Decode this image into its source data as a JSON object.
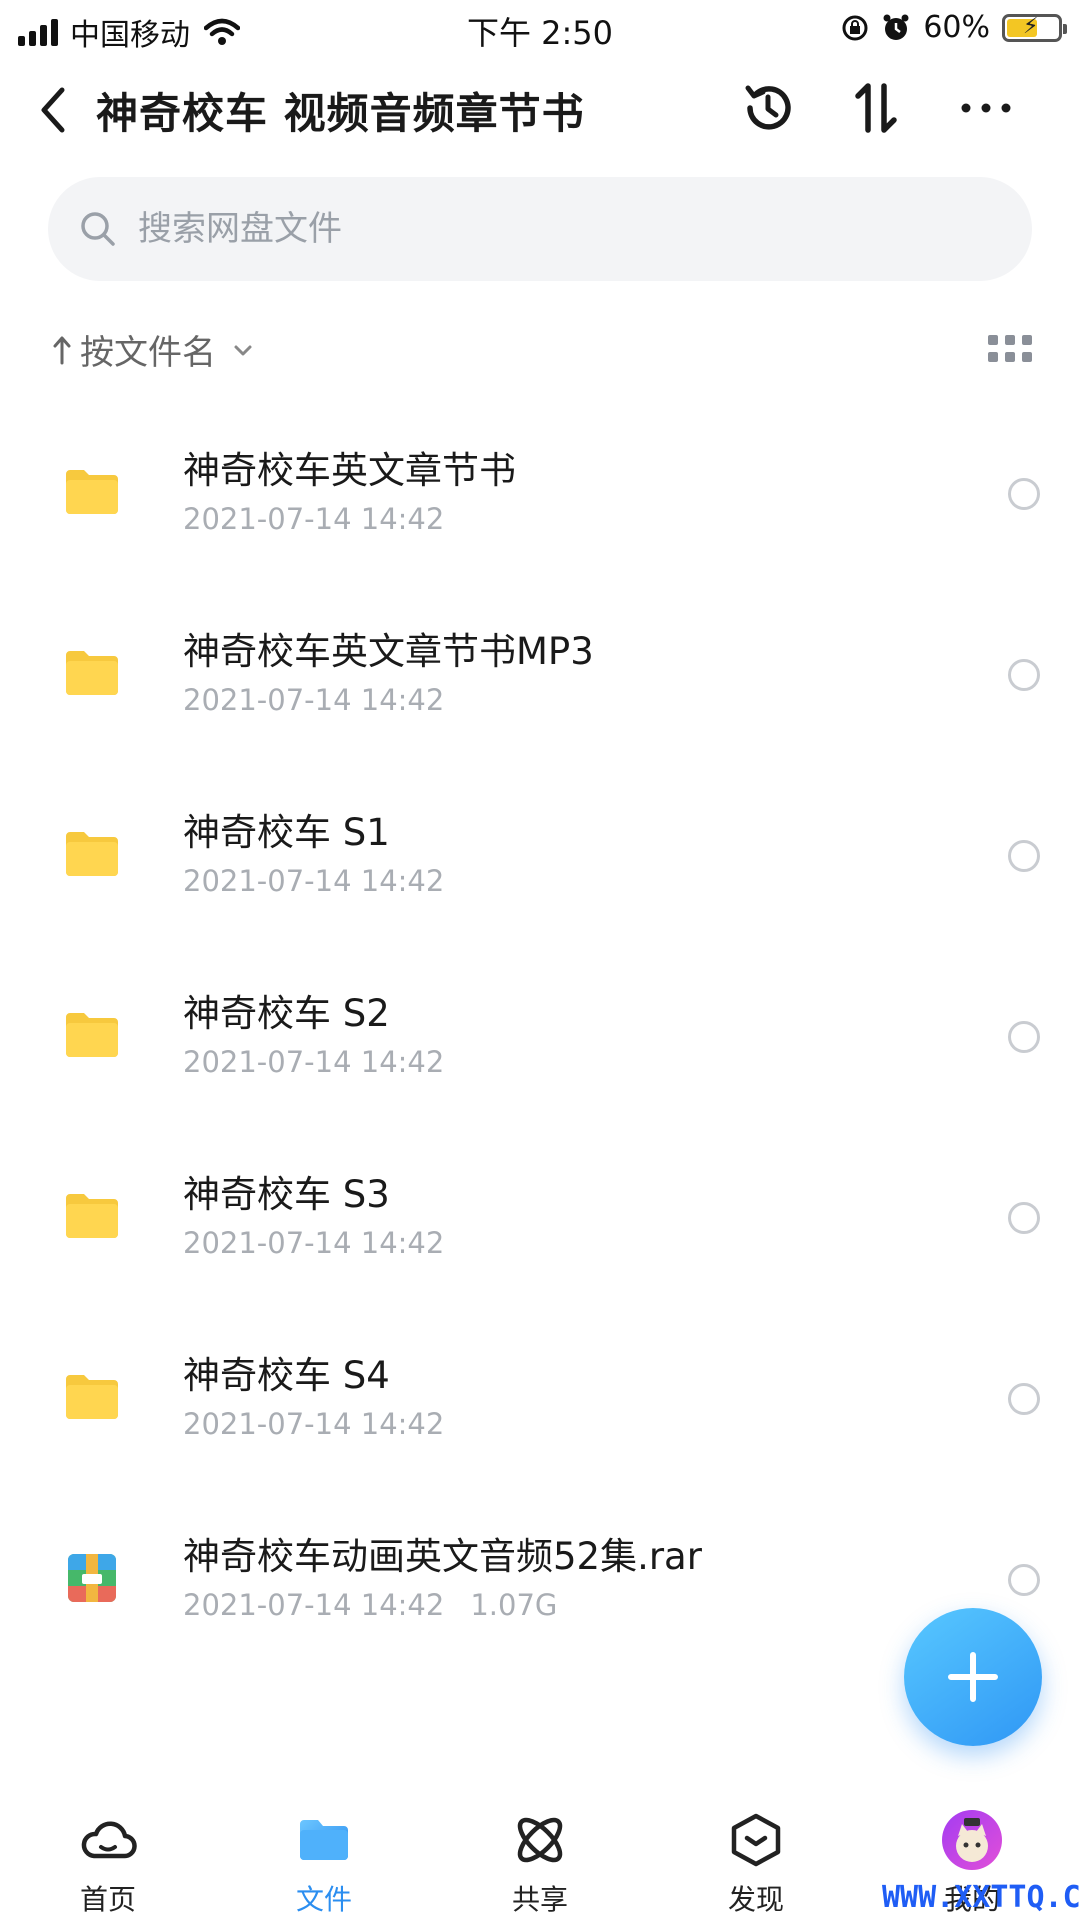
{
  "status_bar": {
    "carrier": "中国移动",
    "time": "下午 2:50",
    "battery_percent": "60%",
    "battery_level": 0.6,
    "icons": [
      "signal-icon",
      "wifi-icon",
      "rotation-lock-icon",
      "alarm-icon",
      "battery-charging-icon"
    ]
  },
  "header": {
    "title": "神奇校车 视频音频章节书",
    "icons": [
      "back-icon",
      "history-icon",
      "sort-transfer-icon",
      "more-icon"
    ]
  },
  "search": {
    "placeholder": "搜索网盘文件"
  },
  "sort": {
    "label": "按文件名"
  },
  "files": [
    {
      "name": "神奇校车英文章节书",
      "date": "2021-07-14 14:42",
      "size": "",
      "type": "folder"
    },
    {
      "name": "神奇校车英文章节书MP3",
      "date": "2021-07-14 14:42",
      "size": "",
      "type": "folder"
    },
    {
      "name": "神奇校车 S1",
      "date": "2021-07-14 14:42",
      "size": "",
      "type": "folder"
    },
    {
      "name": "神奇校车 S2",
      "date": "2021-07-14 14:42",
      "size": "",
      "type": "folder"
    },
    {
      "name": "神奇校车 S3",
      "date": "2021-07-14 14:42",
      "size": "",
      "type": "folder"
    },
    {
      "name": "神奇校车 S4",
      "date": "2021-07-14 14:42",
      "size": "",
      "type": "folder"
    },
    {
      "name": "神奇校车动画英文音频52集.rar",
      "date": "2021-07-14 14:42",
      "size": "1.07G",
      "type": "archive"
    }
  ],
  "bottom_nav": [
    {
      "label": "首页",
      "icon": "cloud-icon",
      "active": false
    },
    {
      "label": "文件",
      "icon": "folder-icon",
      "active": true
    },
    {
      "label": "共享",
      "icon": "share-atom-icon",
      "active": false
    },
    {
      "label": "发现",
      "icon": "discover-box-icon",
      "active": false
    },
    {
      "label": "我的",
      "icon": "avatar",
      "active": false
    }
  ],
  "colors": {
    "accent": "#2b8ef0",
    "folder": "#ffd44f",
    "fab": "#3aa7f8"
  },
  "watermark": "WWW.XXTTQ.COM"
}
